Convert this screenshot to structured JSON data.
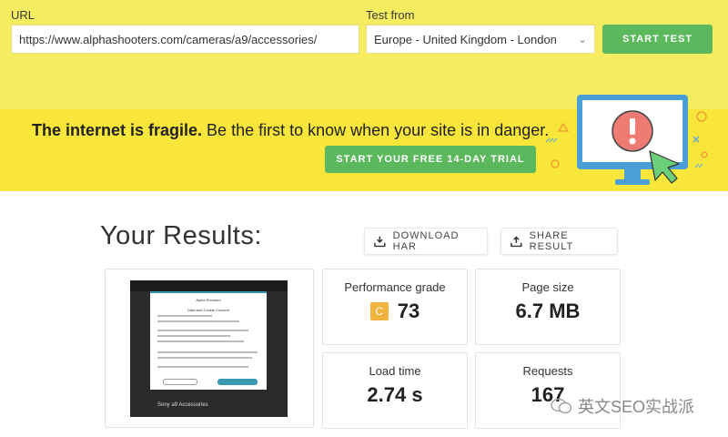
{
  "form": {
    "url_label": "URL",
    "url_value": "https://www.alphashooters.com/cameras/a9/accessories/",
    "test_from_label": "Test from",
    "test_from_value": "Europe - United Kingdom - London",
    "start_label": "START TEST"
  },
  "promo": {
    "bold_text": "The internet is fragile.",
    "rest_text": " Be the first to know when your site is in danger.",
    "trial_label": "START YOUR FREE 14-DAY TRIAL"
  },
  "results": {
    "title": "Your Results:",
    "download_har_label": "DOWNLOAD HAR",
    "share_label": "SHARE RESULT",
    "metrics": {
      "performance_label": "Performance grade",
      "performance_grade": "C",
      "performance_score": "73",
      "page_size_label": "Page size",
      "page_size_value": "6.7 MB",
      "load_time_label": "Load time",
      "load_time_value": "2.74 s",
      "requests_label": "Requests",
      "requests_value": "167"
    }
  },
  "thumbnail": {
    "modal_title": "Alpha Shooters",
    "modal_subtitle": "Data and Cookie Consent",
    "caption": "Sony a9 Accessories"
  },
  "watermark": {
    "text": "英文SEO实战派"
  },
  "colors": {
    "top_band": "#f6ec60",
    "promo_band": "#f9e63a",
    "accent_green": "#5cb85c",
    "grade_c": "#f0b33d"
  }
}
